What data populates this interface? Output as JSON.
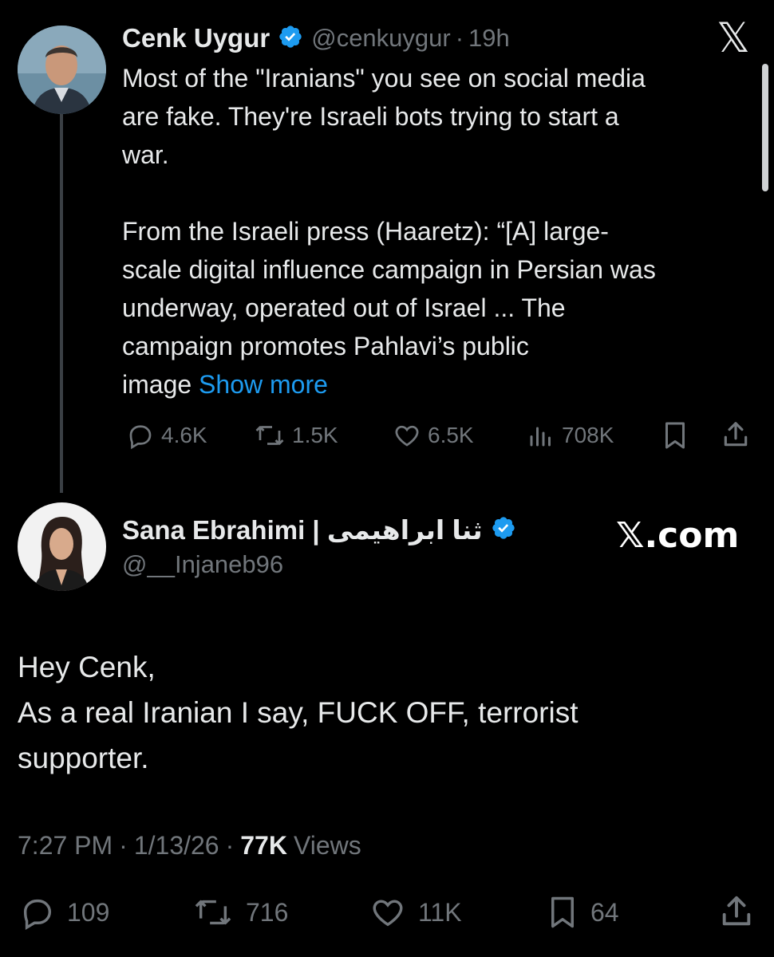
{
  "tweet1": {
    "name": "Cenk Uygur",
    "handle": "@cenkuygur",
    "dot": "·",
    "time": "19h",
    "text_line1": "Most of the \"Iranians\" you see on social media",
    "text_line2": "are fake. They're Israeli bots trying to start a",
    "text_line3": "war.",
    "text_line4": "From the Israeli press (Haaretz): “[A] large-",
    "text_line5": "scale digital influence campaign in Persian was",
    "text_line6": "underway, operated out of Israel ... The",
    "text_line7": "campaign promotes Pahlavi’s public",
    "text_line8": "image",
    "show_more": "Show more",
    "replies": "4.6K",
    "reposts": "1.5K",
    "likes": "6.5K",
    "views": "708K"
  },
  "brand": {
    "x_logo": "𝕏",
    "site": "𝕏.com"
  },
  "tweet2": {
    "name": "Sana Ebrahimi | ثنا ابراهیمی",
    "handle": "@__Injaneb96",
    "line1": "Hey Cenk,",
    "line2": "As a real Iranian I say, FUCK OFF, terrorist",
    "line3": "supporter.",
    "time": "7:27 PM",
    "sep1": "·",
    "date": "1/13/26",
    "sep2": "·",
    "views_count": "77K",
    "views_label": "Views",
    "replies": "109",
    "reposts": "716",
    "likes": "11K",
    "bookmarks": "64"
  },
  "colors": {
    "background": "#000000",
    "text": "#e7e9ea",
    "muted": "#71767b",
    "link": "#1d9bf0",
    "verified": "#1d9bf0"
  }
}
